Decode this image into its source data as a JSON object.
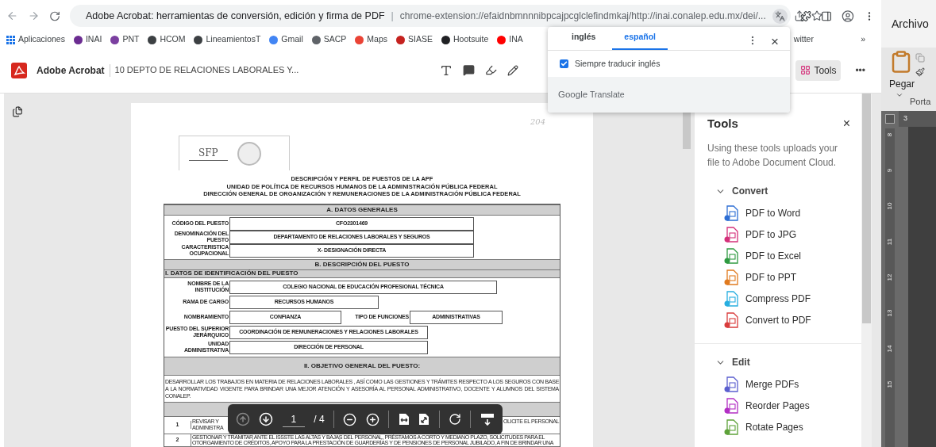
{
  "browser": {
    "omnibox": {
      "title": "Adobe Acrobat: herramientas de conversión, edición y firma de PDF",
      "separator": "|",
      "url": "chrome-extension://efaidnbmnnnibpcajpcglclefindmkaj/http://inai.conalep.edu.mx/dei/..."
    },
    "bookmarks": [
      {
        "label": "Aplicaciones",
        "color": "#1a73e8"
      },
      {
        "label": "INAI",
        "color": "#6b2c91"
      },
      {
        "label": "PNT",
        "color": "#7b3fa0"
      },
      {
        "label": "HCOM",
        "color": "#3c4043"
      },
      {
        "label": "LineamientosT",
        "color": "#3c4043"
      },
      {
        "label": "Gmail",
        "color": "#4285f4"
      },
      {
        "label": "SACP",
        "color": "#5f6368"
      },
      {
        "label": "Maps",
        "color": "#ea4335"
      },
      {
        "label": "SIASE",
        "color": "#c5221f"
      },
      {
        "label": "Hootsuite",
        "color": "#202124"
      },
      {
        "label": "INA",
        "color": "#ff0000"
      }
    ],
    "bookmark_after_popup": "witter",
    "overflow": "»"
  },
  "acrobat": {
    "app_name": "Adobe Acrobat",
    "file_name": "10 DEPTO DE RELACIONES LABORALES Y...",
    "tools_button": {
      "label": "Tools",
      "selected": true
    },
    "more": "•••"
  },
  "document": {
    "handwritten_mark": "204",
    "logo": "SFP",
    "headings": [
      "DESCRIPCIÓN Y PERFIL DE PUESTOS DE LA APF",
      "UNIDAD DE POLÍTICA DE RECURSOS HUMANOS DE LA ADMINISTRACIÓN PÚBLICA FEDERAL",
      "DIRECCIÓN GENERAL DE ORGANIZACIÓN Y REMUNERACIONES DE LA ADMINISTRACIÓN PÚBLICA FEDERAL"
    ],
    "section_a": {
      "title": "A. DATOS GENERALES",
      "rows": [
        [
          {
            "label": "CÓDIGO DEL PUESTO",
            "value": "CFO2301469"
          }
        ],
        [
          {
            "label": "DENOMINACIÓN DEL PUESTO",
            "value": "DEPARTAMENTO DE RELACIONES LABORALES Y SEGUROS"
          }
        ],
        [
          {
            "label": "CARACTERISTICA OCUPACIONAL",
            "value": "X- DESIGNACIÓN DIRECTA"
          }
        ]
      ]
    },
    "section_b": {
      "title": "B. DESCRIPCIÓN DEL PUESTO",
      "subtitle": "I. DATOS DE IDENTIFICACIÓN DEL PUESTO",
      "rows": [
        [
          {
            "label": "NOMBRE DE LA INSTITUCIÓN",
            "value": "COLEGIO NACIONAL DE EDUCACIÓN PROFESIONAL TÉCNICA"
          }
        ],
        [
          {
            "label": "RAMA DE CARGO",
            "value": "RECURSOS HUMANOS"
          }
        ],
        [
          {
            "label": "NOMBRAMIENTO",
            "value": "CONFIANZA"
          },
          {
            "label": "TIPO DE FUNCIONES",
            "value": "ADMINISTRATIVAS"
          }
        ],
        [
          {
            "label": "PUESTO DEL SUPERIOR JERÁRQUICO",
            "value": "COORDINACIÓN DE REMUNERACIONES Y RELACIONES LABORALES"
          }
        ],
        [
          {
            "label": "UNIDAD ADMINISTRATIVA",
            "value": "DIRECCIÓN DE PERSONAL"
          }
        ]
      ]
    },
    "objective": {
      "title": "II. OBJETIVO GENERAL DEL PUESTO:",
      "text": "DESARROLLAR LOS TRABAJOS EN MATERIA DE RELACIONES LABORALES , ASÍ COMO LAS GESTIONES Y TRÁMITES RESPECTO A LOS SEGUROS CON BASE A LA NORMATIVIDAD VIGENTE PARA BRINDAR UNA MEJOR ATENCIÓN Y ASESORÍA AL PERSONAL ADMINISTRATIVO, DOCENTE Y ALUMNOS DEL SISTEMA CONALEP."
    },
    "functions": [
      {
        "number": "1",
        "text_left": "REVISAR Y ADMINISTRA",
        "text_right": "OLICITE EL PERSONAL"
      },
      {
        "number": "2",
        "text_left": "GESTIONAR Y TRAMITAR ANTE EL ISSSTE LAS ALTAS Y BAJAS DEL PERSONAL, PRÉSTAMOS A CORTO Y MEDIANO PLAZO, SOLICITUDES PARA EL OTORGAMIENTO DE CRÉDITOS, APOYO PARA LA PRESTACIÓN DE GUARDERÍAS Y DE PENSIONES DE PERSONAL JUBILADO, A FIN DE BRINDAR UNA"
      }
    ]
  },
  "page_toolbar": {
    "page": "1",
    "total": "/ 4"
  },
  "tools_panel": {
    "title": "Tools",
    "close": "×",
    "note": "Using these tools uploads your file to Adobe Document Cloud.",
    "sections": [
      {
        "title": "Convert",
        "expanded": true,
        "items": [
          {
            "label": "PDF to Word",
            "color": "#2d6ed4"
          },
          {
            "label": "PDF to JPG",
            "color": "#d4307a"
          },
          {
            "label": "PDF to Excel",
            "color": "#2f9a41"
          },
          {
            "label": "PDF to PPT",
            "color": "#e07a1e"
          },
          {
            "label": "Compress PDF",
            "color": "#27aee0"
          },
          {
            "label": "Convert to PDF",
            "color": "#d93c3c"
          }
        ]
      },
      {
        "title": "Edit",
        "expanded": true,
        "items": [
          {
            "label": "Merge PDFs",
            "color": "#5b5fcf"
          },
          {
            "label": "Reorder Pages",
            "color": "#b22fc4"
          },
          {
            "label": "Rotate Pages",
            "color": "#5ea23a"
          }
        ]
      }
    ]
  },
  "translate_popup": {
    "tabs": [
      {
        "label": "inglés",
        "selected": false
      },
      {
        "label": "español",
        "selected": true
      }
    ],
    "close": "×",
    "always_translate": {
      "label": "Siempre traducir inglés",
      "checked": true
    },
    "footer_brand": "Google",
    "footer_product": "Translate"
  },
  "word": {
    "menu": "Archivo",
    "paste": "Pegar",
    "clipboard": "Porta",
    "ruler_h": "3",
    "ruler_v": [
      "8",
      "9",
      "10",
      "11",
      "12",
      "13",
      "14",
      "15"
    ]
  }
}
